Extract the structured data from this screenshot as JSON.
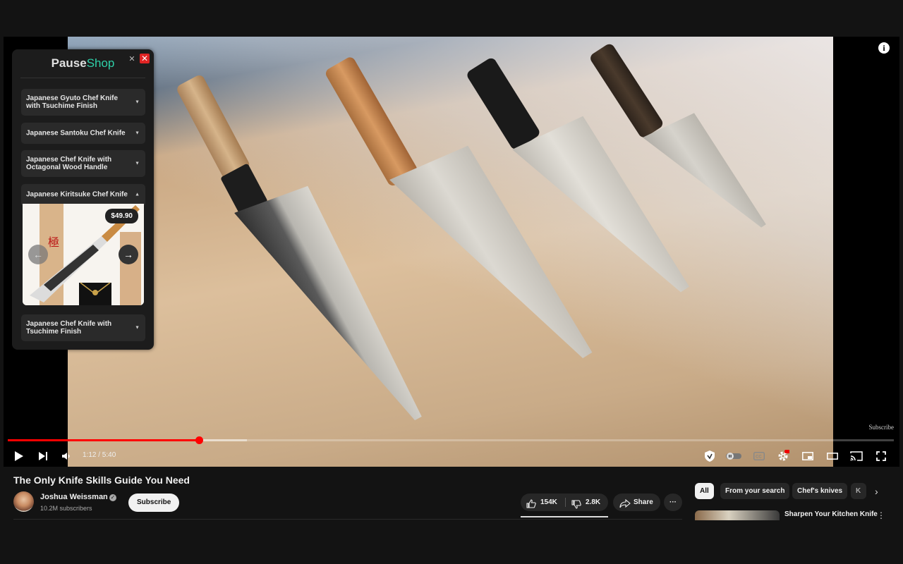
{
  "player": {
    "info_icon": "info-icon",
    "watermark": "Subscribe",
    "time": "1:12 / 5:40",
    "progress_fraction": 0.216,
    "accent_color": "#ff0000"
  },
  "pauseshop": {
    "title_part1": "Pause",
    "title_part2": "Shop",
    "items": [
      {
        "label": "Japanese Gyuto Chef Knife with Tsuchime Finish",
        "arrow": "▼"
      },
      {
        "label": "Japanese Santoku Chef Knife",
        "arrow": "▼"
      },
      {
        "label": "Japanese Chef Knife with Octagonal Wood Handle",
        "arrow": "▼"
      },
      {
        "label": "Japanese Kiritsuke Chef Knife",
        "arrow": "▲"
      },
      {
        "label": "Japanese Chef Knife with Tsuchime Finish",
        "arrow": "▼"
      }
    ],
    "product_price": "$49.90",
    "prev_icon": "arrow-left-icon",
    "next_icon": "arrow-right-icon"
  },
  "video": {
    "title": "The Only Knife Skills Guide You Need"
  },
  "channel": {
    "name": "Joshua Weissman",
    "subscribers": "10.2M subscribers",
    "subscribe_label": "Subscribe"
  },
  "actions": {
    "likes": "154K",
    "dislikes": "2.8K",
    "share_label": "Share",
    "more_label": "···"
  },
  "chips": [
    "All",
    "From your search",
    "Chef's knives",
    "K"
  ],
  "recommended": {
    "title": "Sharpen Your Kitchen Knife"
  }
}
